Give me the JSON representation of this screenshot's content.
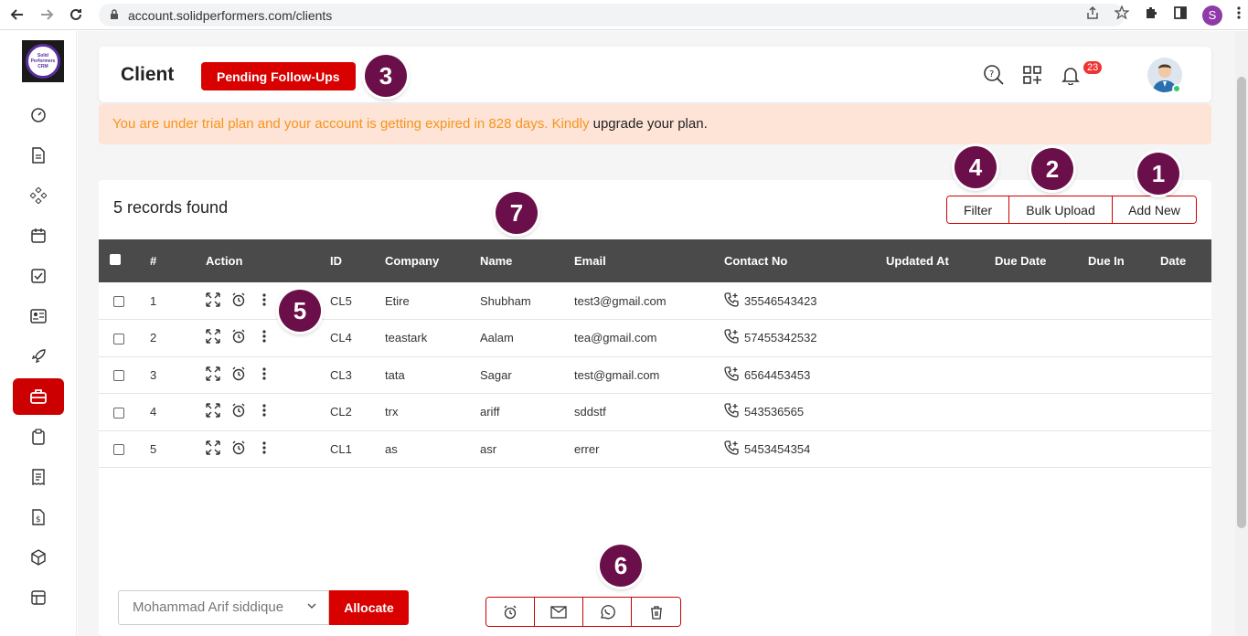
{
  "browser": {
    "url": "account.solidperformers.com/clients",
    "profile_initial": "S"
  },
  "logo": {
    "line1": "Solid Performers",
    "line2": "CRM"
  },
  "header": {
    "title": "Client",
    "pending_label": "Pending Follow-Ups",
    "notification_count": "23"
  },
  "banner": {
    "warning_text": "You are under trial plan and your account is getting expired in 828 days. Kindly ",
    "link_text": "upgrade your plan",
    "suffix": "."
  },
  "records_text": "5 records found",
  "toolbar": {
    "filter": "Filter",
    "bulk_upload": "Bulk Upload",
    "add_new": "Add New"
  },
  "table": {
    "columns": [
      "#",
      "Action",
      "ID",
      "Company",
      "Name",
      "Email",
      "Contact No",
      "Updated At",
      "Due Date",
      "Due In",
      "Date"
    ],
    "rows": [
      {
        "num": "1",
        "id": "CL5",
        "company": "Etire",
        "name": "Shubham",
        "email": "test3@gmail.com",
        "contact": "35546543423"
      },
      {
        "num": "2",
        "id": "CL4",
        "company": "teastark",
        "name": "Aalam",
        "email": "tea@gmail.com",
        "contact": "57455342532"
      },
      {
        "num": "3",
        "id": "CL3",
        "company": "tata",
        "name": "Sagar",
        "email": "test@gmail.com",
        "contact": "6564453453"
      },
      {
        "num": "4",
        "id": "CL2",
        "company": "trx",
        "name": "ariff",
        "email": "sddstf",
        "contact": "543536565"
      },
      {
        "num": "5",
        "id": "CL1",
        "company": "as",
        "name": "asr",
        "email": "errer",
        "contact": "5453454354"
      }
    ]
  },
  "allocate": {
    "selected_user": "Mohammad Arif siddique",
    "button": "Allocate"
  },
  "markers": [
    "1",
    "2",
    "3",
    "4",
    "5",
    "6",
    "7"
  ],
  "colors": {
    "accent": "#d90000",
    "marker": "#6b0f4a",
    "table_header": "#4a4a4a",
    "banner_bg": "#fde4d6",
    "banner_text": "#f7941d"
  },
  "sidebar_icons": [
    "dashboard-icon",
    "document-icon",
    "modules-icon",
    "calendar-icon",
    "checkbox-icon",
    "id-card-icon",
    "rocket-icon",
    "briefcase-icon",
    "clipboard-icon",
    "receipt-icon",
    "invoice-icon",
    "box-icon",
    "table-icon"
  ]
}
